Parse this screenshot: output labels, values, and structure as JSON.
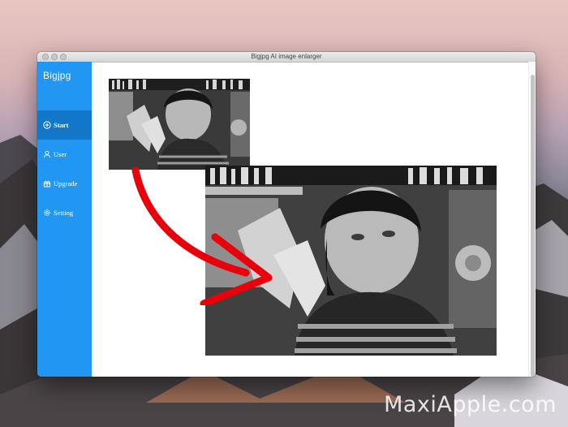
{
  "window": {
    "title": "Bigjpg AI image enlarger"
  },
  "sidebar": {
    "brand": "Bigjpg",
    "items": [
      {
        "label": "Start",
        "icon": "plus-circle-icon",
        "active": true
      },
      {
        "label": "User",
        "icon": "user-icon",
        "active": false
      },
      {
        "label": "Upgrade",
        "icon": "gift-icon",
        "active": false
      },
      {
        "label": "Setting",
        "icon": "gear-icon",
        "active": false
      }
    ]
  },
  "content": {
    "small_image": "original-photo",
    "large_image": "enlarged-photo",
    "arrow_color": "#e8000b"
  },
  "watermark": "MaxiApple.com",
  "colors": {
    "sidebar": "#2296f3",
    "sidebar_active": "#1276c9"
  }
}
